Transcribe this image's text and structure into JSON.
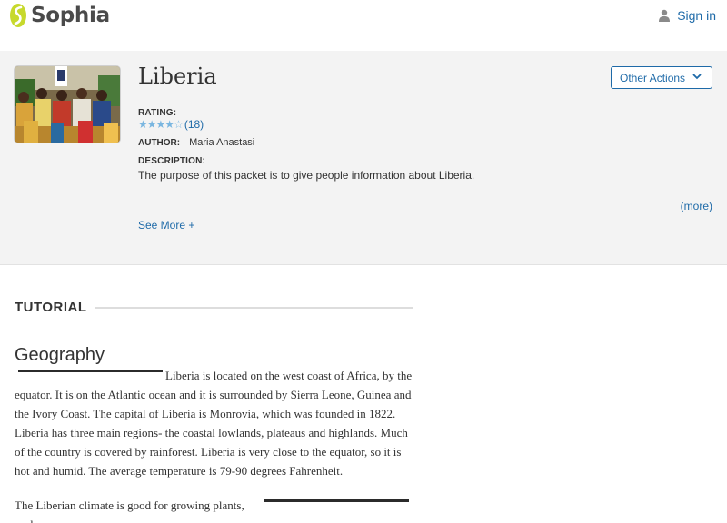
{
  "header": {
    "brand": "Sophia",
    "signin_label": "Sign in"
  },
  "resource": {
    "title": "Liberia",
    "other_actions_label": "Other Actions",
    "rating_label": "RATING:",
    "rating_stars": 4,
    "rating_count": "(18)",
    "author_label": "AUTHOR:",
    "author": "Maria Anastasi",
    "description_label": "DESCRIPTION:",
    "description": "The purpose of this packet is to give people information about Liberia.",
    "more_label": "(more)",
    "see_more_label": "See More +"
  },
  "content": {
    "section_label": "TUTORIAL",
    "heading": "Geography",
    "paragraph1": "Liberia is located on the west coast of Africa, by the equator. It is on the Atlantic ocean and it is surrounded by Sierra Leone, Guinea and the Ivory Coast. The capital of Liberia is Monrovia, which was founded in 1822. Liberia has three main regions- the coastal lowlands, plateaus and highlands. Much of the country is covered by rainforest. Liberia is very close to the equator, so it is hot and humid.  The average temperature is 79-90 degrees Fahrenheit.",
    "paragraph2": "The Liberian climate is good for growing plants, such"
  },
  "colors": {
    "brand_green": "#c7d92c",
    "link_blue": "#1e6aa8",
    "star_blue": "#7ab6e0",
    "hero_bg": "#f3f3f3"
  },
  "icons": {
    "logo": "sophia-logo-icon",
    "signin": "person-icon",
    "dropdown": "chevron-down-icon",
    "star": "star-icon"
  }
}
